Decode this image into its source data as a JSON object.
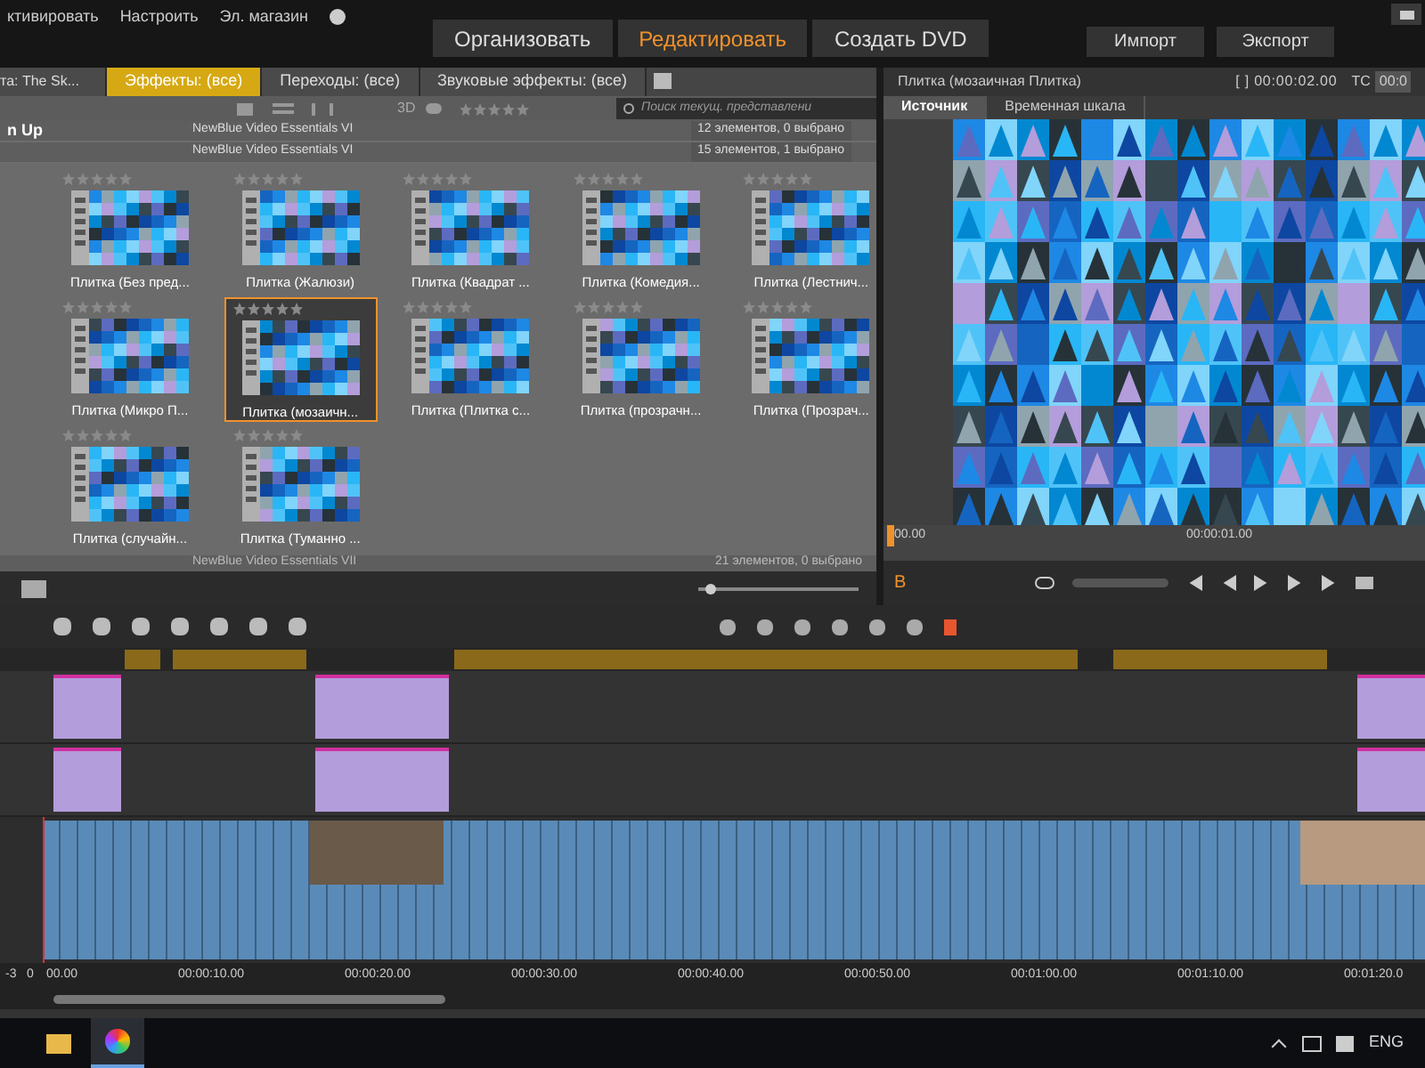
{
  "menu": [
    "ктивировать",
    "Настроить",
    "Эл. магазин"
  ],
  "modes": [
    {
      "label": "Организовать",
      "selected": false
    },
    {
      "label": "Редактировать",
      "selected": true
    },
    {
      "label": "Создать DVD",
      "selected": false
    }
  ],
  "actions": [
    "Импорт",
    "Экспорт"
  ],
  "library": {
    "tabs": [
      {
        "label": "та: The Sk...",
        "selected": false
      },
      {
        "label": "Эффекты: (все)",
        "selected": true
      },
      {
        "label": "Переходы: (все)",
        "selected": false
      },
      {
        "label": "Звуковые эффекты: (все)",
        "selected": false
      }
    ],
    "view_label": "3D",
    "search": {
      "placeholder": "Поиск текущ. представлени"
    },
    "groups": [
      {
        "name": "n Up",
        "title": "NewBlue Video Essentials VI",
        "count": "12 элементов, 0 выбрано"
      },
      {
        "title": "NewBlue Video Essentials VI",
        "count": "15 элементов, 1 выбрано"
      }
    ],
    "filter": {
      "stars": 0
    },
    "zoom": {
      "level": 0.05
    },
    "items": [
      {
        "label": "Плитка (Без пред...",
        "selected": false,
        "stars": 0
      },
      {
        "label": "Плитка (Жалюзи)",
        "selected": false,
        "stars": 0
      },
      {
        "label": "Плитка (Квадрат ...",
        "selected": false,
        "stars": 0
      },
      {
        "label": "Плитка (Комедия...",
        "selected": false,
        "stars": 0
      },
      {
        "label": "Плитка (Лестнич...",
        "selected": false,
        "stars": 0
      },
      {
        "label": "Плитка (Микро П...",
        "selected": false,
        "stars": 0
      },
      {
        "label": "Плитка (мозаичн...",
        "selected": true,
        "stars": 0
      },
      {
        "label": "Плитка (Плитка с...",
        "selected": false,
        "stars": 0
      },
      {
        "label": "Плитка (прозрачн...",
        "selected": false,
        "stars": 0
      },
      {
        "label": "Плитка (Прозрач...",
        "selected": false,
        "stars": 0
      },
      {
        "label": "Плитка (случайн...",
        "selected": false,
        "stars": 0
      },
      {
        "label": "Плитка (Туманно ...",
        "selected": false,
        "stars": 0
      }
    ],
    "footer": {
      "title": "NewBlue Video Essentials VII",
      "count": "21 элементов, 0 выбрано"
    }
  },
  "player": {
    "title": "Плитка (мозаичная Плитка)",
    "duration": "[ ] 00:00:02.00",
    "tc_label": "TC",
    "tc": "00:0",
    "tabs": [
      {
        "label": "Источник",
        "selected": true
      },
      {
        "label": "Временная шкала",
        "selected": false
      }
    ],
    "ruler": [
      "00.00",
      "00:00:01.00"
    ],
    "mark": "B"
  },
  "timeline": {
    "ruler": [
      "00.00",
      "00:00:10.00",
      "00:00:20.00",
      "00:00:30.00",
      "00:00:40.00",
      "00:00:50.00",
      "00:01:00.00",
      "00:01:10.00",
      "00:01:20.0"
    ],
    "meter": [
      "-3",
      "0"
    ]
  },
  "taskbar": {
    "lang": "ENG"
  }
}
